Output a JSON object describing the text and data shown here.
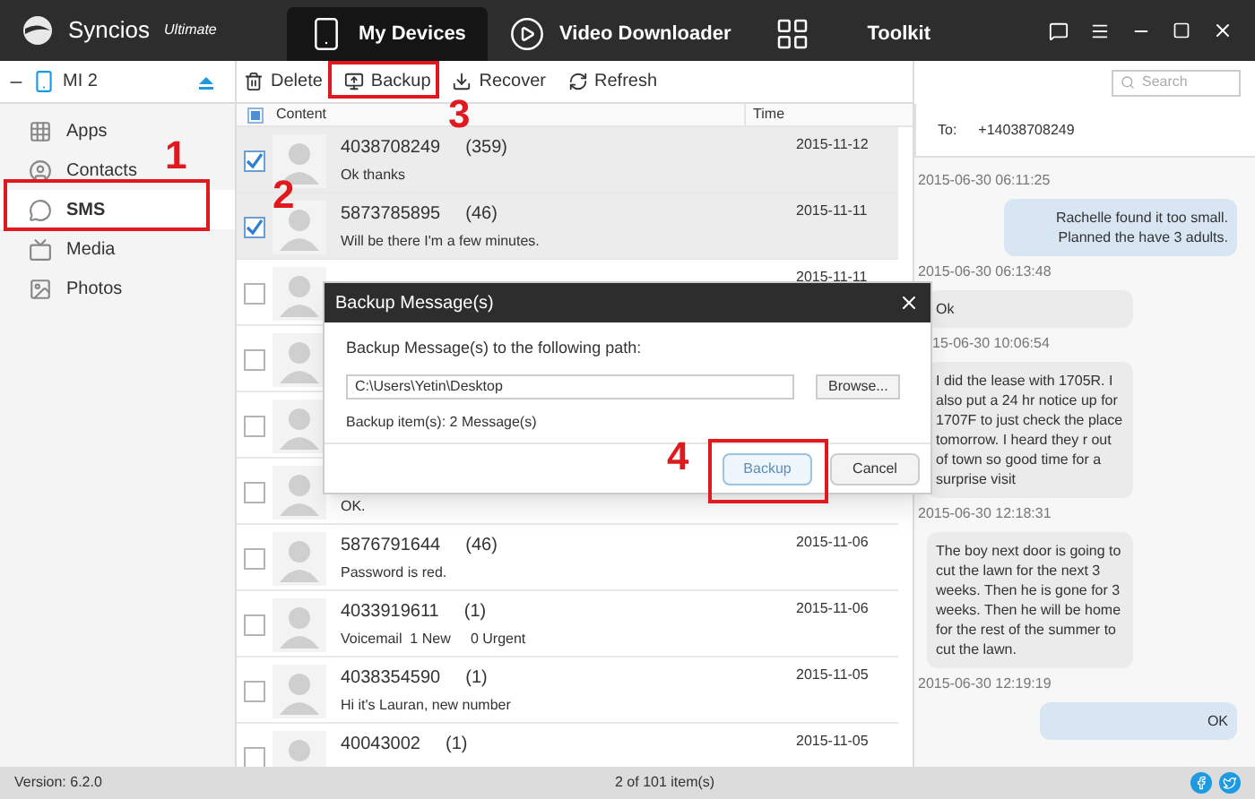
{
  "app": {
    "name": "Syncios",
    "edition": "Ultimate"
  },
  "tabs": [
    {
      "label": "My Devices",
      "selected": true,
      "kind": "phone"
    },
    {
      "label": "Video Downloader",
      "selected": false,
      "kind": "play"
    },
    {
      "label": "Toolkit",
      "selected": false,
      "kind": "grid"
    }
  ],
  "device": {
    "name": "MI 2"
  },
  "sidebar": {
    "items": [
      {
        "label": "Apps",
        "kind": "apps",
        "selected": false
      },
      {
        "label": "Contacts",
        "kind": "contacts",
        "selected": false
      },
      {
        "label": "SMS",
        "kind": "sms",
        "selected": true
      },
      {
        "label": "Media",
        "kind": "media",
        "selected": false
      },
      {
        "label": "Photos",
        "kind": "photos",
        "selected": false
      }
    ]
  },
  "toolbar": [
    {
      "label": "Delete",
      "kind": "delete"
    },
    {
      "label": "Backup",
      "kind": "backup"
    },
    {
      "label": "Recover",
      "kind": "recover"
    },
    {
      "label": "Refresh",
      "kind": "refresh"
    }
  ],
  "search": {
    "placeholder": "Search"
  },
  "table": {
    "columns": [
      "Content",
      "Time"
    ],
    "select_all_partial": true,
    "rows": [
      {
        "checked": true,
        "number": "4038708249",
        "count": "(359)",
        "preview": "Ok thanks",
        "time": "2015-11-12"
      },
      {
        "checked": true,
        "number": "5873785895",
        "count": "(46)",
        "preview": "Will be there I'm a few minutes.",
        "time": "2015-11-11"
      },
      {
        "checked": false,
        "time": "2015-11-11"
      },
      {
        "checked": false
      },
      {
        "checked": false
      },
      {
        "checked": false,
        "preview": "OK."
      },
      {
        "checked": false,
        "number": "5876791644",
        "count": "(46)",
        "preview": "Password is red.",
        "time": "2015-11-06"
      },
      {
        "checked": false,
        "number": "4033919611",
        "count": "(1)",
        "preview": "Voicemail  1 New     0 Urgent",
        "time": "2015-11-06"
      },
      {
        "checked": false,
        "number": "4038354590",
        "count": "(1)",
        "preview": "Hi it's Lauran, new number",
        "time": "2015-11-05"
      },
      {
        "checked": false,
        "number": "40043002",
        "count": "(1)",
        "time": "2015-11-05"
      }
    ]
  },
  "chat": {
    "to_label": "To:",
    "to": "+14038708249",
    "messages": [
      {
        "time": "2015-06-30 06:11:25",
        "kind": "sent",
        "text": "Rachelle found it too small. Planned the have 3 adults."
      },
      {
        "time": "2015-06-30 06:13:48",
        "kind": "received",
        "text": "Ok"
      },
      {
        "time": "15-06-30 10:06:54",
        "kind": "received",
        "text": "I did the lease with 1705R. I also put a 24 hr notice up for 1707F to just check the place tomorrow. I heard they r out of town so good time for a surprise visit"
      },
      {
        "time": "2015-06-30 12:18:31",
        "kind": "received",
        "text": "The boy next door is going to cut the lawn for the next 3 weeks. Then he is gone for 3 weeks. Then he will be home for the rest of the summer to cut the lawn."
      },
      {
        "time": "2015-06-30 12:19:19",
        "kind": "sent",
        "text": "OK"
      }
    ]
  },
  "status_bar": {
    "version": "Version: 6.2.0",
    "count": "2 of 101 item(s)"
  },
  "dialog": {
    "title": "Backup Message(s)",
    "prompt": "Backup Message(s) to the following path:",
    "path": "C:\\Users\\Yetin\\Desktop",
    "browse": "Browse...",
    "summary": "Backup item(s): 2 Message(s)",
    "buttons": [
      "Backup",
      "Cancel"
    ]
  },
  "annotations": [
    "1",
    "2",
    "3",
    "4"
  ]
}
